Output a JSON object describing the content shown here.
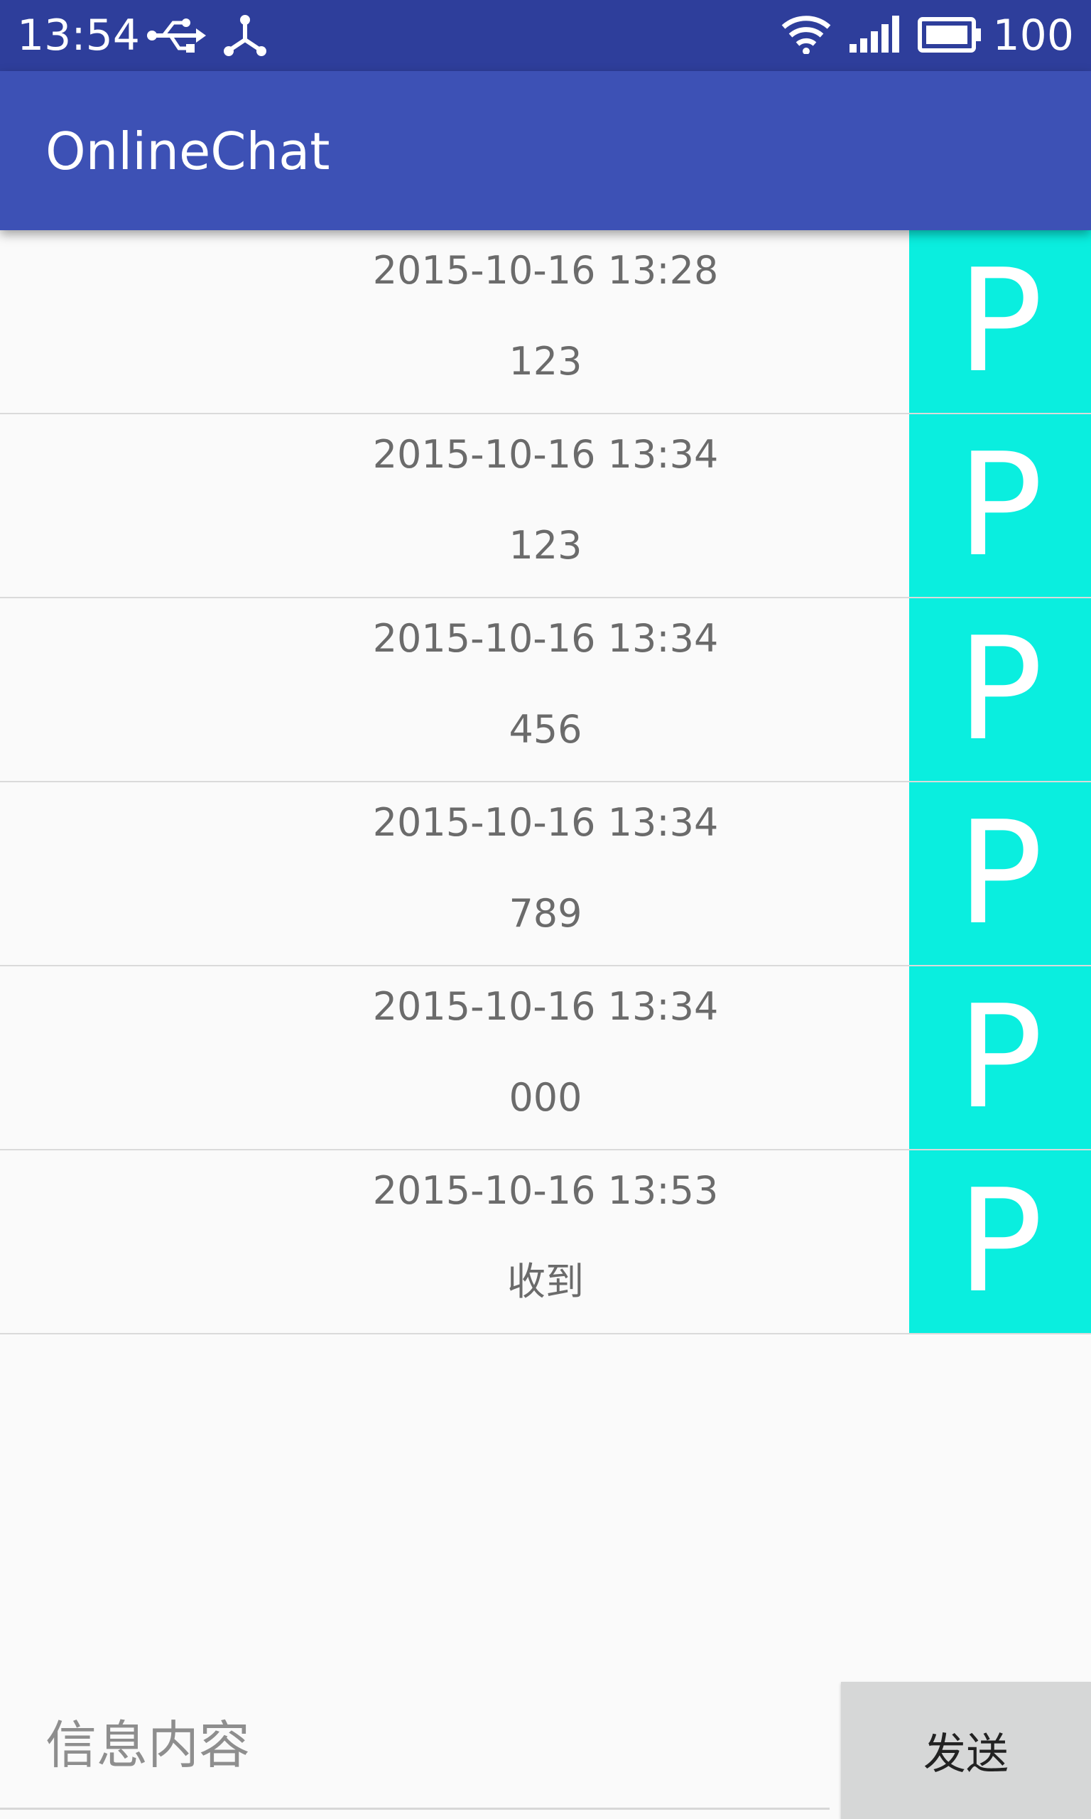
{
  "status_bar": {
    "time": "13:54",
    "battery": "100",
    "icons": [
      "usb-icon",
      "share-icon",
      "wifi-icon",
      "signal-icon",
      "battery-icon"
    ]
  },
  "app_bar": {
    "title": "OnlineChat",
    "color": "#3d51b5"
  },
  "messages": [
    {
      "time": "2015-10-16 13:28",
      "content": "123",
      "avatar": "P"
    },
    {
      "time": "2015-10-16 13:34",
      "content": "123",
      "avatar": "P"
    },
    {
      "time": "2015-10-16 13:34",
      "content": "456",
      "avatar": "P"
    },
    {
      "time": "2015-10-16 13:34",
      "content": "789",
      "avatar": "P"
    },
    {
      "time": "2015-10-16 13:34",
      "content": "000",
      "avatar": "P"
    },
    {
      "time": "2015-10-16 13:53",
      "content": "收到",
      "avatar": "P"
    }
  ],
  "composer": {
    "placeholder": "信息内容",
    "value": "",
    "send_label": "发送"
  },
  "colors": {
    "status_bar": "#2e3e9b",
    "avatar_bg": "#0aeedf",
    "send_bg": "#d6d7d7"
  }
}
